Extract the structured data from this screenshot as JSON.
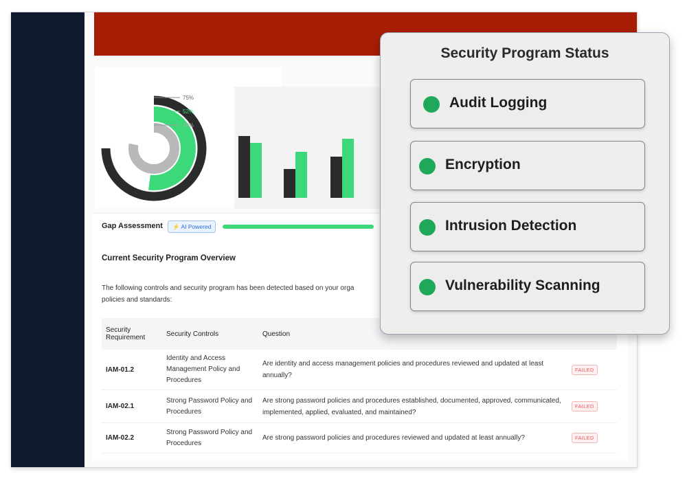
{
  "donut": {
    "labels": [
      "75%",
      "52%",
      "78%"
    ],
    "colors": [
      "#2b2b2b",
      "#3dd87a",
      "#b8b8b8"
    ]
  },
  "bar_chart": {
    "groups": [
      {
        "dark": 90,
        "green": 80
      },
      {
        "dark": 42,
        "green": 67
      },
      {
        "dark": 60,
        "green": 86
      }
    ],
    "colors": {
      "dark": "#2b2b2b",
      "green": "#3dd87a"
    }
  },
  "gap": {
    "title": "Gap Assessment",
    "badge": "AI Powered",
    "progress": 1.0
  },
  "overview": {
    "title": "Current Security Program Overview",
    "description": "The following controls and security program has been detected based on your orga policies and standards:"
  },
  "table": {
    "headers": [
      "Security Requirement",
      "Security Controls",
      "Question"
    ],
    "rows": [
      {
        "id": "IAM-01.2",
        "control": "Identity and Access Management Policy and Procedures",
        "question": "Are identity and access management policies and procedures reviewed and updated at least annually?",
        "status": "FAILED"
      },
      {
        "id": "IAM-02.1",
        "control": "Strong Password Policy and Procedures",
        "question": "Are strong password policies and procedures established, documented, approved, communicated, implemented, applied, evaluated, and maintained?",
        "status": "FAILED"
      },
      {
        "id": "IAM-02.2",
        "control": "Strong Password Policy and Procedures",
        "question": "Are strong password policies and procedures reviewed and updated at least annually?",
        "status": "FAILED"
      }
    ]
  },
  "status_panel": {
    "title": "Security Program Status",
    "items": [
      {
        "label": "Audit Logging",
        "color": "#1fa85a"
      },
      {
        "label": "Encryption",
        "color": "#1fa85a"
      },
      {
        "label": "Intrusion Detection",
        "color": "#1fa85a"
      },
      {
        "label": "Vulnerability Scanning",
        "color": "#1fa85a"
      }
    ]
  },
  "colors": {
    "header": "#a81d05",
    "sidebar": "#0f1a2e",
    "accent": "#3dd87a"
  }
}
